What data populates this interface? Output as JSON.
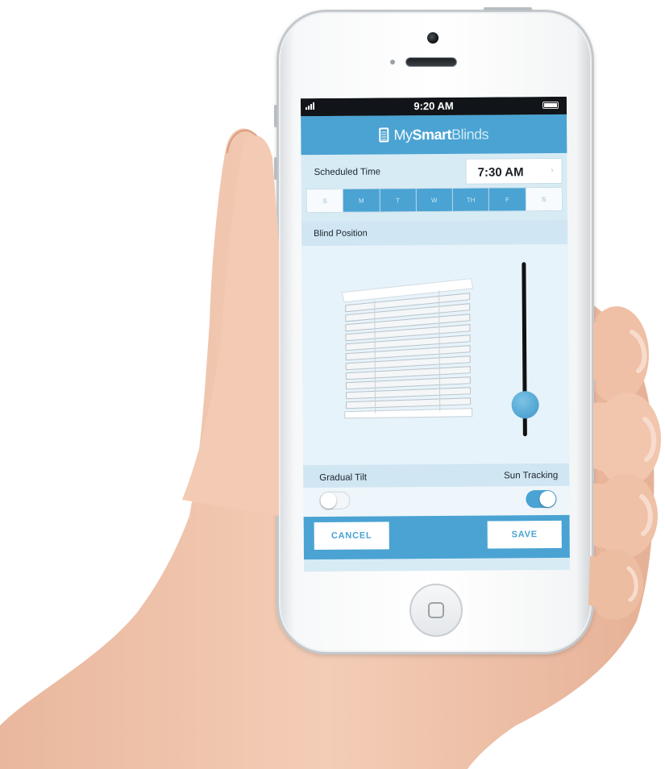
{
  "status_bar": {
    "time": "9:20 AM"
  },
  "app": {
    "logo_part1": "My",
    "logo_part2": "Smart",
    "logo_part3": "Blinds"
  },
  "schedule": {
    "label": "Scheduled Time",
    "time_value": "7:30 AM",
    "days": [
      {
        "label": "S",
        "selected": false
      },
      {
        "label": "M",
        "selected": true
      },
      {
        "label": "T",
        "selected": true
      },
      {
        "label": "W",
        "selected": true
      },
      {
        "label": "TH",
        "selected": true
      },
      {
        "label": "F",
        "selected": true
      },
      {
        "label": "S",
        "selected": false
      }
    ]
  },
  "blind_position": {
    "label": "Blind Position",
    "slider_value_percent": 18
  },
  "options": {
    "gradual_tilt_label": "Gradual Tilt",
    "gradual_tilt_on": false,
    "sun_tracking_label": "Sun Tracking",
    "sun_tracking_on": true
  },
  "footer": {
    "cancel_label": "CANCEL",
    "save_label": "SAVE"
  },
  "colors": {
    "accent": "#4aa3d3",
    "light_panel": "#d7ebf5",
    "skin": "#f0c3ab"
  }
}
